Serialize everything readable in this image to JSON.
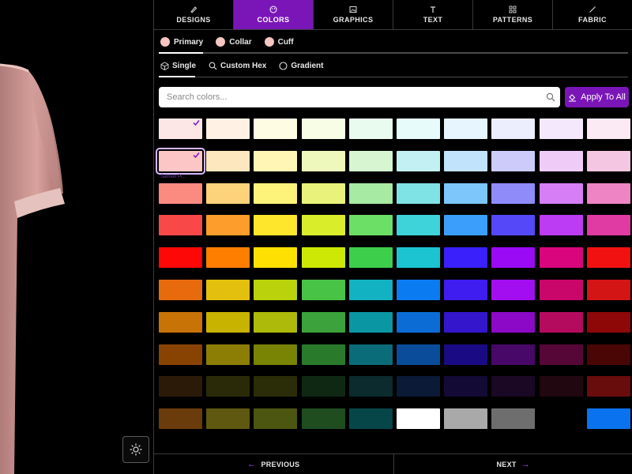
{
  "tabs": [
    {
      "label": "DESIGNS",
      "icon": "brush-icon"
    },
    {
      "label": "COLORS",
      "icon": "palette-icon",
      "active": true
    },
    {
      "label": "GRAPHICS",
      "icon": "image-icon"
    },
    {
      "label": "TEXT",
      "icon": "text-icon"
    },
    {
      "label": "PATTERNS",
      "icon": "grid-icon"
    },
    {
      "label": "FABRIC",
      "icon": "needle-icon"
    }
  ],
  "parts": [
    {
      "label": "Primary",
      "color": "#f6c6c3",
      "active": true
    },
    {
      "label": "Collar",
      "color": "#f6c6c3"
    },
    {
      "label": "Cuff",
      "color": "#f6c6c3"
    }
  ],
  "modes": [
    {
      "label": "Single",
      "icon": "cube-icon",
      "active": true
    },
    {
      "label": "Custom Hex",
      "icon": "search-icon"
    },
    {
      "label": "Gradient",
      "icon": "circle-icon"
    }
  ],
  "search": {
    "placeholder": "Search colors..."
  },
  "apply_button": {
    "label": "Apply To All"
  },
  "selected_color_label": "Salmon Pi...",
  "swatches": [
    [
      "#fde6e6",
      "#fff1e4",
      "#fffce4",
      "#f8fde6",
      "#e9fbef",
      "#e7fbfb",
      "#e6f5fe",
      "#ecedfd",
      "#f4e8fd",
      "#fbe9f3"
    ],
    [
      "#fcc6c6",
      "#fde7bf",
      "#fff6b5",
      "#eef8bc",
      "#d6f5d0",
      "#c3f0f2",
      "#c2e3fc",
      "#cccbfa",
      "#efcbf8",
      "#f5c6e2"
    ],
    [
      "#fb8a80",
      "#fcd27a",
      "#fdf37a",
      "#e9f27a",
      "#a7eaa3",
      "#7fe3e5",
      "#7cc6fb",
      "#8f8cfa",
      "#d57ef6",
      "#ee84c4"
    ],
    [
      "#f94848",
      "#fd9d2b",
      "#fde62b",
      "#d9ed2b",
      "#6cdf66",
      "#3dd3d8",
      "#3c9efb",
      "#5548f8",
      "#bb3cf2",
      "#e03aa3"
    ],
    [
      "#fd0707",
      "#fe7f00",
      "#fee103",
      "#cce804",
      "#3dcf4b",
      "#1cc4d2",
      "#3a20fb",
      "#9a0af4",
      "#d8057d",
      "#f21111"
    ],
    [
      "#e76b0d",
      "#e3c00d",
      "#b9d20b",
      "#48c345",
      "#12b2c3",
      "#0b7bf2",
      "#3f1cf0",
      "#a30ef0",
      "#c9076b",
      "#d31515"
    ],
    [
      "#c77306",
      "#c8b300",
      "#adba0a",
      "#3ca33c",
      "#0a97a3",
      "#0b6cd6",
      "#3416cc",
      "#8c09c7",
      "#b50b5e",
      "#8e0808"
    ],
    [
      "#884303",
      "#8c7e05",
      "#798404",
      "#2a7a2c",
      "#0a6c78",
      "#0a4c9a",
      "#1a0a83",
      "#470867",
      "#560737",
      "#4a0505"
    ],
    [
      "#2c1a08",
      "#2b2a08",
      "#2a2d08",
      "#0f2814",
      "#0b2b2e",
      "#0b1a36",
      "#130a36",
      "#1a0824",
      "#21070f",
      "#690c0c"
    ],
    [
      "#6b3c0b",
      "#5f5810",
      "#4d5610",
      "#1f4d20",
      "#074648",
      "#ffffff",
      "#a9a9a9",
      "#6e6e6e",
      "#000000",
      "#0a72ee"
    ]
  ],
  "footer": {
    "previous": "PREVIOUS",
    "next": "NEXT"
  }
}
